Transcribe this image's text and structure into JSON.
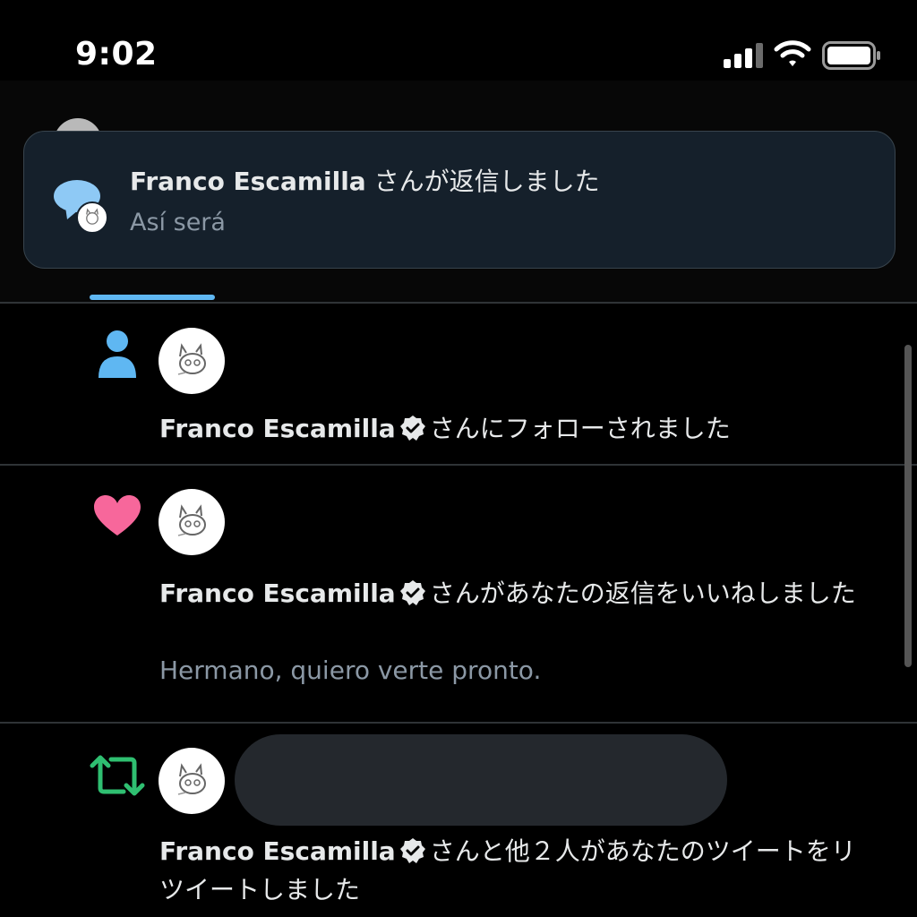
{
  "status_bar": {
    "time": "9:02"
  },
  "toast": {
    "name": "Franco Escamilla",
    "action": "さんが返信しました",
    "subtitle": "Así será"
  },
  "notifications": [
    {
      "icon": "person-icon",
      "name": "Franco Escamilla",
      "action": "さんにフォローされました"
    },
    {
      "icon": "heart-icon",
      "name": "Franco Escamilla",
      "action": "さんがあなたの返信をいいねしました",
      "quote": "Hermano, quiero verte pronto."
    },
    {
      "icon": "retweet-icon",
      "name": "Franco Escamilla",
      "action": "さんと他２人があなたのツイートをリツイートしました"
    }
  ],
  "colors": {
    "accent": "#1d9bf0",
    "like": "#f7679b",
    "retweet": "#2fbf71",
    "toast_bg": "#15202b"
  }
}
